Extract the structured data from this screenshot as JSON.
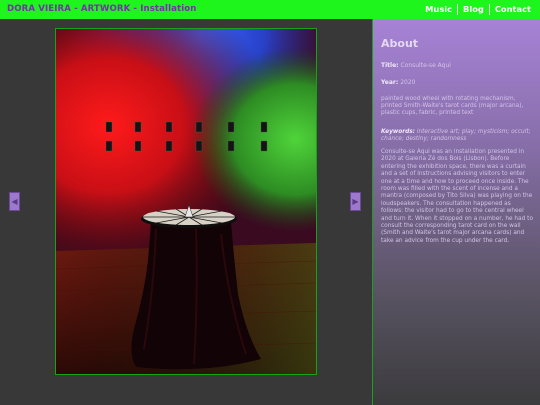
{
  "header": {
    "title": "DORA VIEIRA - ARTWORK - Installation",
    "nav": [
      {
        "label": "Music"
      },
      {
        "label": "Blog"
      },
      {
        "label": "Contact"
      }
    ]
  },
  "gallery": {
    "image_alt": "Installation photo: round table with tarot wheel under red, blue and green lights"
  },
  "about": {
    "heading": "About",
    "title_label": "Title:",
    "title_value": "Consulte-se Aqui",
    "year_label": "Year:",
    "year_value": "2020",
    "materials": "painted wood wheel with rotating mechanism, printed Smith-Waite's tarot cards (major arcana), plastic cups, fabric, printed text",
    "keywords_label": "Keywords:",
    "keywords_value": "interactive art; play; mysticism; occult; chance; destiny; randomness",
    "description": "Consulte-se Aqui was an installation presented in 2020 at Galeria Zé dos Bois (Lisbon). Before entering the exhibition space, there was a curtain and a set of instructions advising visitors to enter one at a time and how to proceed once inside. The room was filled with the scent of incense and a mantra (composed by Tito Silva) was playing on the loudspeakers. The consultation happened as follows: the visitor had to go to the central wheel and turn it. When it stopped on a number, he had to consult the corresponding tarot card on the wall (Smith and Waite's tarot major arcana cards) and take an advice from the cup under the card."
  },
  "colors": {
    "topbar": "#1df51d",
    "title_text": "#7a2fae",
    "accent_border": "#1aa11a",
    "sidebar_top": "#a782d6"
  }
}
